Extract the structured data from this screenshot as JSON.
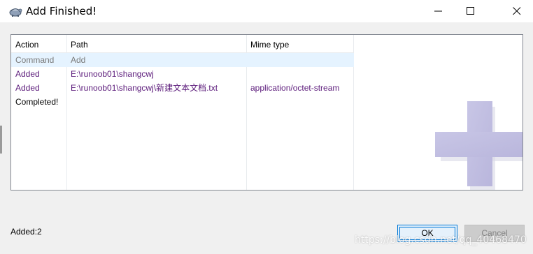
{
  "window": {
    "title": "Add Finished!",
    "controls": [
      "minimize-icon",
      "maximize-icon",
      "close-icon"
    ]
  },
  "log": {
    "columns": [
      "Action",
      "Path",
      "Mime type"
    ],
    "rows": [
      {
        "action": "Command",
        "path": "Add",
        "mime": "",
        "selected": true,
        "color": "#7a7a7a"
      },
      {
        "action": "Added",
        "path": "E:\\runoob01\\shangcwj",
        "mime": "",
        "color": "#5b1a7a"
      },
      {
        "action": "Added",
        "path": "E:\\runoob01\\shangcwj\\新建文本文档.txt",
        "mime": "application/octet-stream",
        "color": "#5b1a7a"
      },
      {
        "action": "Completed!",
        "path": "",
        "mime": "",
        "color": "#000000"
      }
    ]
  },
  "status": {
    "text": "Added:2"
  },
  "buttons": {
    "ok": "OK",
    "cancel": "Cancel"
  },
  "watermark": "https://blog.csdn.net/qq_40468470",
  "colors": {
    "accent": "#0078d7",
    "added": "#5b1a7a",
    "plus_icon": "#c8c6e6"
  }
}
